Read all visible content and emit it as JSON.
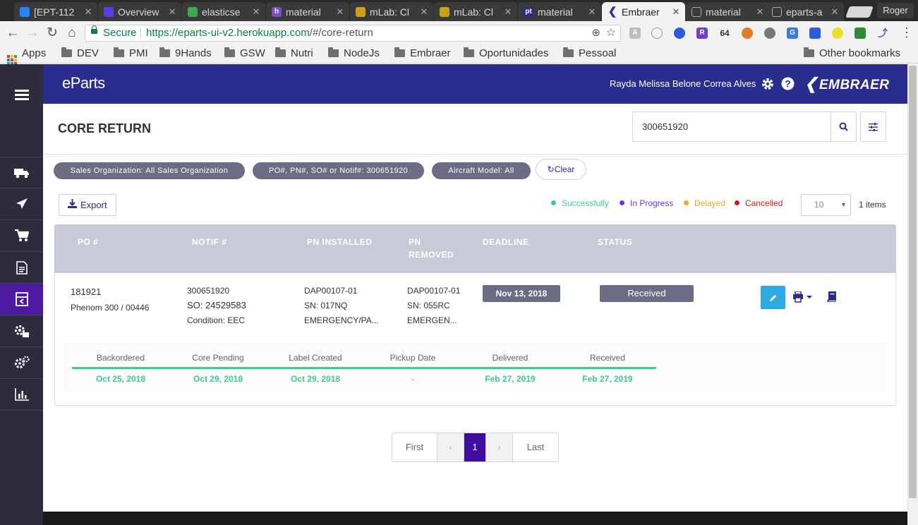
{
  "browser": {
    "tabs": [
      {
        "title": "[EPT-112",
        "favicon": "jira",
        "color": "#2684ff"
      },
      {
        "title": "Overview",
        "favicon": "shield",
        "color": "#5b3ee8"
      },
      {
        "title": "elasticse",
        "favicon": "elastic",
        "color": "#3fa652"
      },
      {
        "title": "material",
        "favicon": "heroku",
        "color": "#7a4dc2"
      },
      {
        "title": "mLab: Cl",
        "favicon": "mlab",
        "color": "#c9a21a"
      },
      {
        "title": "mLab: Cl",
        "favicon": "mlab",
        "color": "#c9a21a"
      },
      {
        "title": "material",
        "favicon": "pt",
        "color": "#2a2c8e"
      },
      {
        "title": "Embraer",
        "favicon": "embraer",
        "color": "#2a2c8e",
        "active": true
      },
      {
        "title": "material",
        "favicon": "doc",
        "color": "#999"
      },
      {
        "title": "eparts-a",
        "favicon": "doc",
        "color": "#999"
      }
    ],
    "profile": "Roger",
    "secure_label": "Secure",
    "url_host": "https://eparts-ui-v2.herokuapp.com",
    "url_path": "/#/core-return",
    "bookmarks": [
      "Apps",
      "DEV",
      "PMI",
      "9Hands",
      "GSW",
      "Nutri",
      "NodeJs",
      "Embraer",
      "Oportunidades",
      "Pessoal",
      "Other bookmarks"
    ]
  },
  "app": {
    "logo": "eParts",
    "user_name": "Rayda Melissa Belone Correa Alves",
    "brand": "EMBRAER",
    "accent": "#2a2c8e",
    "sidebar_items": [
      "menu-icon",
      "truck-icon",
      "airplane-icon",
      "cart-icon",
      "document-icon",
      "core-return-icon",
      "parts-settings-icon",
      "gears-icon",
      "chart-icon"
    ]
  },
  "page": {
    "title": "CORE RETURN",
    "search_value": "300651920",
    "filters": [
      "Sales Organization: All Sales Organization",
      "PO#, PN#, SO# or Notif#: 300651920",
      "Aircraft Model: All"
    ],
    "clear_label": "Clear",
    "export_label": "Export",
    "legend": [
      {
        "label": "Successfully",
        "color": "#3fcc86"
      },
      {
        "label": "In Progress",
        "color": "#5b3ee8"
      },
      {
        "label": "Delayed",
        "color": "#f5a623"
      },
      {
        "label": "Cancelled",
        "color": "#c81d25"
      }
    ],
    "per_page": "10",
    "items_count": "1 items"
  },
  "table": {
    "headers": [
      "PO #",
      "NOTIF #",
      "PN INSTALLED",
      "PN REMOVED",
      "DEADLINE",
      "STATUS"
    ],
    "pn_removed_header": [
      "PN",
      "REMOVED"
    ],
    "row": {
      "po": "181921",
      "aircraft": "Phenom 300 / 00446",
      "notif": "300651920",
      "so": "SO: 24529583",
      "condition": "Condition: EEC",
      "pn_installed": "DAP00107-01",
      "sn_installed": "SN: 017NQ",
      "type_installed": "EMERGENCY/PA...",
      "pn_removed": "DAP00107-01",
      "sn_removed": "SN: 055RC",
      "type_removed": "EMERGEN...",
      "deadline": "Nov 13, 2018",
      "status": "Received"
    },
    "timeline": [
      {
        "label": "Backordered",
        "date": "Oct 25, 2018"
      },
      {
        "label": "Core Pending",
        "date": "Oct 29, 2018"
      },
      {
        "label": "Label Created",
        "date": "Oct 29, 2018"
      },
      {
        "label": "Pickup Date",
        "date": "-"
      },
      {
        "label": "Delivered",
        "date": "Feb 27, 2019"
      },
      {
        "label": "Received",
        "date": "Feb 27, 2019"
      }
    ]
  },
  "pagination": {
    "first": "First",
    "prev": "‹",
    "current": "1",
    "next": "›",
    "last": "Last"
  }
}
